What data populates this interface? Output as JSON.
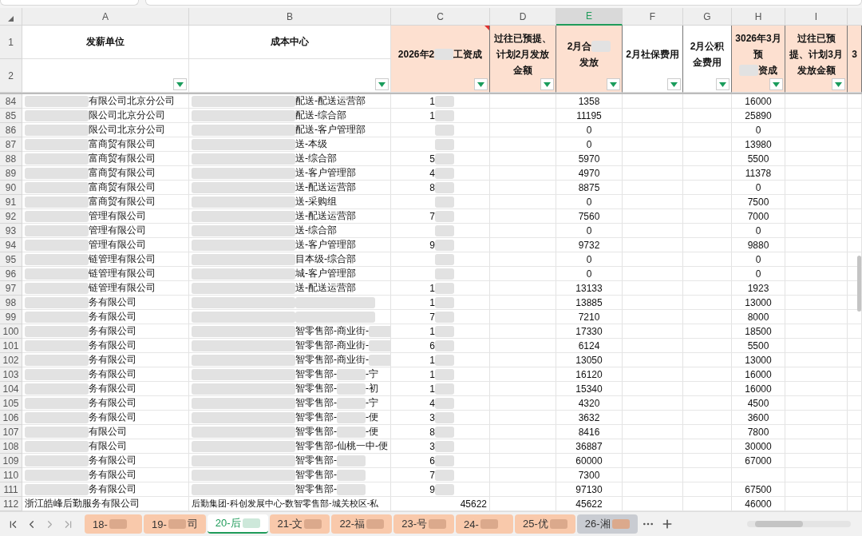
{
  "column_headers": [
    {
      "label": "A",
      "selected": false
    },
    {
      "label": "B",
      "selected": false
    },
    {
      "label": "C",
      "selected": false
    },
    {
      "label": "D",
      "selected": false
    },
    {
      "label": "E",
      "selected": true
    },
    {
      "label": "F",
      "selected": false
    },
    {
      "label": "G",
      "selected": false
    },
    {
      "label": "H",
      "selected": false
    },
    {
      "label": "I",
      "selected": false
    }
  ],
  "header_row_numbers": [
    "1",
    "2"
  ],
  "header_cells": [
    {
      "kind": "split",
      "highlight": false,
      "parts": [
        {
          "kind": "text",
          "text": "发薪单位"
        }
      ]
    },
    {
      "kind": "split",
      "highlight": false,
      "parts": [
        {
          "kind": "text",
          "text": "成本中心"
        }
      ]
    },
    {
      "kind": "merged",
      "highlight": true,
      "comment": true,
      "parts": [
        {
          "kind": "text",
          "text": "2026年2"
        },
        {
          "kind": "blur"
        },
        {
          "kind": "text",
          "text": "工资成"
        }
      ]
    },
    {
      "kind": "merged",
      "highlight": true,
      "comment": false,
      "parts": [
        {
          "kind": "text",
          "text": "过往已预提、计划2月发放金额"
        }
      ]
    },
    {
      "kind": "merged",
      "highlight": true,
      "comment": false,
      "parts": [
        {
          "kind": "text",
          "text": "2月合"
        },
        {
          "kind": "blur"
        },
        {
          "kind": "text",
          "text": "发放"
        }
      ]
    },
    {
      "kind": "merged",
      "highlight": false,
      "comment": false,
      "parts": [
        {
          "kind": "text",
          "text": "2月社保费用"
        }
      ]
    },
    {
      "kind": "merged",
      "highlight": false,
      "comment": false,
      "parts": [
        {
          "kind": "text",
          "text": "2月公积金费用"
        }
      ]
    },
    {
      "kind": "merged",
      "highlight": true,
      "comment": false,
      "parts": [
        {
          "kind": "text",
          "text": "3026年3月预"
        },
        {
          "kind": "blur"
        },
        {
          "kind": "text",
          "text": "资成"
        }
      ]
    },
    {
      "kind": "merged",
      "highlight": true,
      "comment": false,
      "parts": [
        {
          "kind": "text",
          "text": "过往已预提、计划3月发放金额"
        }
      ]
    },
    {
      "kind": "merged",
      "highlight": true,
      "comment": false,
      "parts": [
        {
          "kind": "text",
          "text": "3"
        }
      ]
    }
  ],
  "rows": [
    {
      "kind": "masked",
      "row": "84",
      "a": "有限公司北京分公司",
      "b": [
        {
          "kind": "text",
          "text": "配送-配送运营部"
        }
      ],
      "c": "1",
      "e": "1358",
      "h": "16000"
    },
    {
      "kind": "masked",
      "row": "85",
      "a": "限公司北京分公司",
      "b": [
        {
          "kind": "text",
          "text": "配送-综合部"
        }
      ],
      "c": "1",
      "e": "11195",
      "h": "25890"
    },
    {
      "kind": "masked",
      "row": "86",
      "a": "限公司北京分公司",
      "b": [
        {
          "kind": "text",
          "text": "配送-客户管理部"
        }
      ],
      "c": "",
      "e": "0",
      "h": "0"
    },
    {
      "kind": "masked",
      "row": "87",
      "a": "富商贸有限公司",
      "b": [
        {
          "kind": "text",
          "text": "送-本级"
        }
      ],
      "c": "",
      "e": "0",
      "h": "13980"
    },
    {
      "kind": "masked",
      "row": "88",
      "a": "富商贸有限公司",
      "b": [
        {
          "kind": "text",
          "text": "送-综合部"
        }
      ],
      "c": "5",
      "e": "5970",
      "h": "5500"
    },
    {
      "kind": "masked",
      "row": "89",
      "a": "富商贸有限公司",
      "b": [
        {
          "kind": "text",
          "text": "送-客户管理部"
        }
      ],
      "c": "4",
      "e": "4970",
      "h": "11378"
    },
    {
      "kind": "masked",
      "row": "90",
      "a": "富商贸有限公司",
      "b": [
        {
          "kind": "text",
          "text": "送-配送运营部"
        }
      ],
      "c": "8",
      "e": "8875",
      "h": "0"
    },
    {
      "kind": "masked",
      "row": "91",
      "a": "富商贸有限公司",
      "b": [
        {
          "kind": "text",
          "text": "送-采购组"
        }
      ],
      "c": "",
      "e": "0",
      "h": "7500"
    },
    {
      "kind": "masked",
      "row": "92",
      "a": "管理有限公司",
      "b": [
        {
          "kind": "text",
          "text": "送-配送运营部"
        }
      ],
      "c": "7",
      "e": "7560",
      "h": "7000"
    },
    {
      "kind": "masked",
      "row": "93",
      "a": "管理有限公司",
      "b": [
        {
          "kind": "text",
          "text": "送-综合部"
        }
      ],
      "c": "",
      "e": "0",
      "h": "0"
    },
    {
      "kind": "masked",
      "row": "94",
      "a": "管理有限公司",
      "b": [
        {
          "kind": "text",
          "text": "送-客户管理部"
        }
      ],
      "c": "9",
      "e": "9732",
      "h": "9880"
    },
    {
      "kind": "masked",
      "row": "95",
      "a": "链管理有限公司",
      "b": [
        {
          "kind": "text",
          "text": "目本级-综合部"
        }
      ],
      "c": "",
      "e": "0",
      "h": "0"
    },
    {
      "kind": "masked",
      "row": "96",
      "a": "链管理有限公司",
      "b": [
        {
          "kind": "text",
          "text": "城-客户管理部"
        }
      ],
      "c": "",
      "e": "0",
      "h": "0"
    },
    {
      "kind": "masked",
      "row": "97",
      "a": "链管理有限公司",
      "b": [
        {
          "kind": "text",
          "text": "送-配送运营部"
        }
      ],
      "c": "1",
      "e": "13133",
      "h": "1923"
    },
    {
      "kind": "masked",
      "row": "98",
      "a": "务有限公司",
      "b": [
        {
          "kind": "blur"
        }
      ],
      "c": "1",
      "e": "13885",
      "h": "13000"
    },
    {
      "kind": "masked",
      "row": "99",
      "a": "务有限公司",
      "b": [
        {
          "kind": "blur"
        }
      ],
      "c": "7",
      "e": "7210",
      "h": "8000"
    },
    {
      "kind": "masked",
      "row": "100",
      "a": "务有限公司",
      "b": [
        {
          "kind": "text",
          "text": "智零售部-商业街-"
        },
        {
          "kind": "blur"
        }
      ],
      "c": "1",
      "e": "17330",
      "h": "18500"
    },
    {
      "kind": "masked",
      "row": "101",
      "a": "务有限公司",
      "b": [
        {
          "kind": "text",
          "text": "智零售部-商业街-"
        },
        {
          "kind": "blur"
        }
      ],
      "c": "6",
      "e": "6124",
      "h": "5500"
    },
    {
      "kind": "masked",
      "row": "102",
      "a": "务有限公司",
      "b": [
        {
          "kind": "text",
          "text": "智零售部-商业街-"
        },
        {
          "kind": "blur"
        }
      ],
      "c": "1",
      "e": "13050",
      "h": "13000"
    },
    {
      "kind": "masked",
      "row": "103",
      "a": "务有限公司",
      "b": [
        {
          "kind": "text",
          "text": "智零售部-"
        },
        {
          "kind": "blur"
        },
        {
          "kind": "text",
          "text": "-宁"
        }
      ],
      "c": "1",
      "e": "16120",
      "h": "16000"
    },
    {
      "kind": "masked",
      "row": "104",
      "a": "务有限公司",
      "b": [
        {
          "kind": "text",
          "text": "智零售部-"
        },
        {
          "kind": "blur"
        },
        {
          "kind": "text",
          "text": "-初"
        }
      ],
      "c": "1",
      "e": "15340",
      "h": "16000"
    },
    {
      "kind": "masked",
      "row": "105",
      "a": "务有限公司",
      "b": [
        {
          "kind": "text",
          "text": "智零售部-"
        },
        {
          "kind": "blur"
        },
        {
          "kind": "text",
          "text": "-宁"
        }
      ],
      "c": "4",
      "e": "4320",
      "h": "4500"
    },
    {
      "kind": "masked",
      "row": "106",
      "a": "务有限公司",
      "b": [
        {
          "kind": "text",
          "text": "智零售部-"
        },
        {
          "kind": "blur"
        },
        {
          "kind": "text",
          "text": "-便"
        }
      ],
      "c": "3",
      "e": "3632",
      "h": "3600"
    },
    {
      "kind": "masked",
      "row": "107",
      "a": "有限公司",
      "b": [
        {
          "kind": "text",
          "text": "智零售部-"
        },
        {
          "kind": "blur"
        },
        {
          "kind": "text",
          "text": "-便"
        }
      ],
      "c": "8",
      "e": "8416",
      "h": "7800"
    },
    {
      "kind": "masked",
      "row": "108",
      "a": "有限公司",
      "b": [
        {
          "kind": "text",
          "text": "智零售部-仙桃一中-便"
        }
      ],
      "c": "3",
      "e": "36887",
      "h": "30000"
    },
    {
      "kind": "masked",
      "row": "109",
      "a": "务有限公司",
      "b": [
        {
          "kind": "text",
          "text": "智零售部-"
        },
        {
          "kind": "blur"
        }
      ],
      "c": "6",
      "e": "60000",
      "h": "67000"
    },
    {
      "kind": "masked",
      "row": "110",
      "a": "务有限公司",
      "b": [
        {
          "kind": "text",
          "text": "智零售部-"
        },
        {
          "kind": "blur"
        }
      ],
      "c": "7",
      "e": "7300",
      "h": ""
    },
    {
      "kind": "masked",
      "row": "111",
      "a": "务有限公司",
      "b": [
        {
          "kind": "text",
          "text": "智零售部-"
        },
        {
          "kind": "blur"
        }
      ],
      "c": "9",
      "e": "97130",
      "h": "67500"
    },
    {
      "kind": "plain",
      "row": "112",
      "a": "浙江皓峰后勤服务有限公司",
      "b": [
        {
          "kind": "text",
          "text": "后勤集团-科创发展中心-数智零售部-城关校区-私"
        }
      ],
      "c": "45622",
      "e": "45622",
      "h": "46000"
    }
  ],
  "sheet_tabs": [
    {
      "parts": [
        {
          "kind": "text",
          "text": "18-"
        },
        {
          "kind": "blur"
        }
      ],
      "selected": false,
      "color": "#f9c9ab"
    },
    {
      "parts": [
        {
          "kind": "text",
          "text": "19-"
        },
        {
          "kind": "blur"
        },
        {
          "kind": "text",
          "text": "司"
        }
      ],
      "selected": false,
      "color": "#f9c9ab"
    },
    {
      "parts": [
        {
          "kind": "text",
          "text": "20-后"
        },
        {
          "kind": "blur"
        }
      ],
      "selected": true,
      "color": "#ffffff"
    },
    {
      "parts": [
        {
          "kind": "text",
          "text": "21-文"
        },
        {
          "kind": "blur"
        }
      ],
      "selected": false,
      "color": "#f9c9ab"
    },
    {
      "parts": [
        {
          "kind": "text",
          "text": "22-福"
        },
        {
          "kind": "blur"
        }
      ],
      "selected": false,
      "color": "#f9c9ab"
    },
    {
      "parts": [
        {
          "kind": "text",
          "text": "23-号"
        },
        {
          "kind": "blur"
        }
      ],
      "selected": false,
      "color": "#f9c9ab"
    },
    {
      "parts": [
        {
          "kind": "text",
          "text": "24-"
        },
        {
          "kind": "blur"
        }
      ],
      "selected": false,
      "color": "#f9c9ab"
    },
    {
      "parts": [
        {
          "kind": "text",
          "text": "25-优"
        },
        {
          "kind": "blur"
        }
      ],
      "selected": false,
      "color": "#f9c9ab"
    },
    {
      "parts": [
        {
          "kind": "text",
          "text": "26-湘"
        },
        {
          "kind": "blur"
        }
      ],
      "selected": false,
      "color": "#c9ccd2"
    }
  ]
}
